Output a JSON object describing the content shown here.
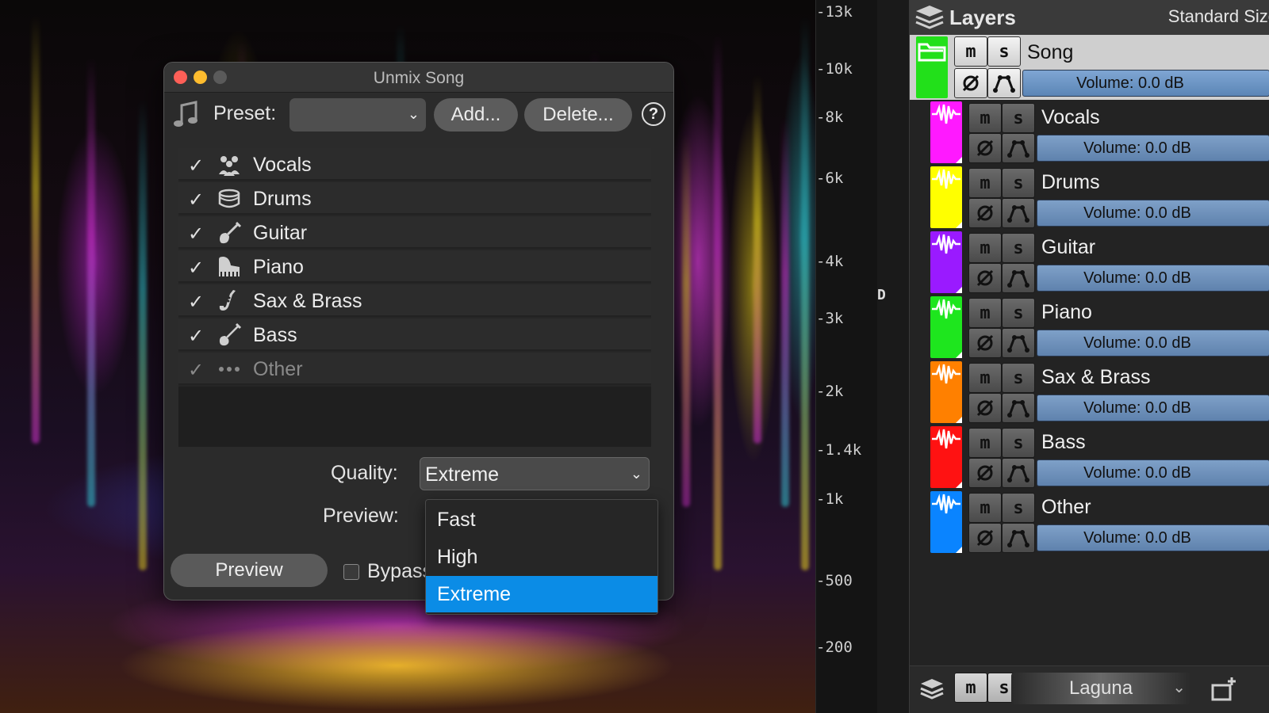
{
  "dialog": {
    "title": "Unmix Song",
    "preset_label": "Preset:",
    "preset_value": "",
    "add_label": "Add...",
    "delete_label": "Delete...",
    "help_label": "?",
    "stems": [
      {
        "label": "Vocals",
        "checked": true,
        "icon": "vocals-icon"
      },
      {
        "label": "Drums",
        "checked": true,
        "icon": "drum-icon"
      },
      {
        "label": "Guitar",
        "checked": true,
        "icon": "guitar-icon"
      },
      {
        "label": "Piano",
        "checked": true,
        "icon": "piano-icon"
      },
      {
        "label": "Sax & Brass",
        "checked": true,
        "icon": "saxophone-icon"
      },
      {
        "label": "Bass",
        "checked": true,
        "icon": "bass-guitar-icon"
      },
      {
        "label": "Other",
        "checked": true,
        "icon": "more-dots-icon"
      }
    ],
    "quality_label": "Quality:",
    "quality_value": "Extreme",
    "quality_options": [
      "Fast",
      "High",
      "Extreme"
    ],
    "preview_label": "Preview:",
    "preview_button": "Preview",
    "bypass_label": "Bypass",
    "check_glyph": "✓"
  },
  "frequency_scale": {
    "ticks": [
      "13k",
      "10k",
      "8k",
      "6k",
      "4k",
      "3k",
      "2k",
      "1.4k",
      "1k",
      "500",
      "200"
    ],
    "marker": "D"
  },
  "layers_panel": {
    "title": "Layers",
    "size_label": "Standard Size",
    "mute_label": "m",
    "solo_label": "s",
    "song": {
      "name": "Song",
      "volume": "Volume: 0.0 dB",
      "color": "#22e01a"
    },
    "layers": [
      {
        "name": "Vocals",
        "volume": "Volume: 0.0 dB",
        "color": "#ff19ff"
      },
      {
        "name": "Drums",
        "volume": "Volume: 0.0 dB",
        "color": "#ffff00"
      },
      {
        "name": "Guitar",
        "volume": "Volume: 0.0 dB",
        "color": "#9a1aff"
      },
      {
        "name": "Piano",
        "volume": "Volume: 0.0 dB",
        "color": "#1ee61e"
      },
      {
        "name": "Sax & Brass",
        "volume": "Volume: 0.0 dB",
        "color": "#ff8000"
      },
      {
        "name": "Bass",
        "volume": "Volume: 0.0 dB",
        "color": "#ff1212"
      },
      {
        "name": "Other",
        "volume": "Volume: 0.0 dB",
        "color": "#0a84ff"
      }
    ],
    "footer": {
      "mute_label": "m",
      "solo_label": "s",
      "preset": "Laguna"
    }
  },
  "colors": {
    "accent": "#0b8ce6",
    "close_light": "#fe5f57",
    "minimize_light": "#febc2e",
    "zoom_light": "#5a5a5a"
  }
}
